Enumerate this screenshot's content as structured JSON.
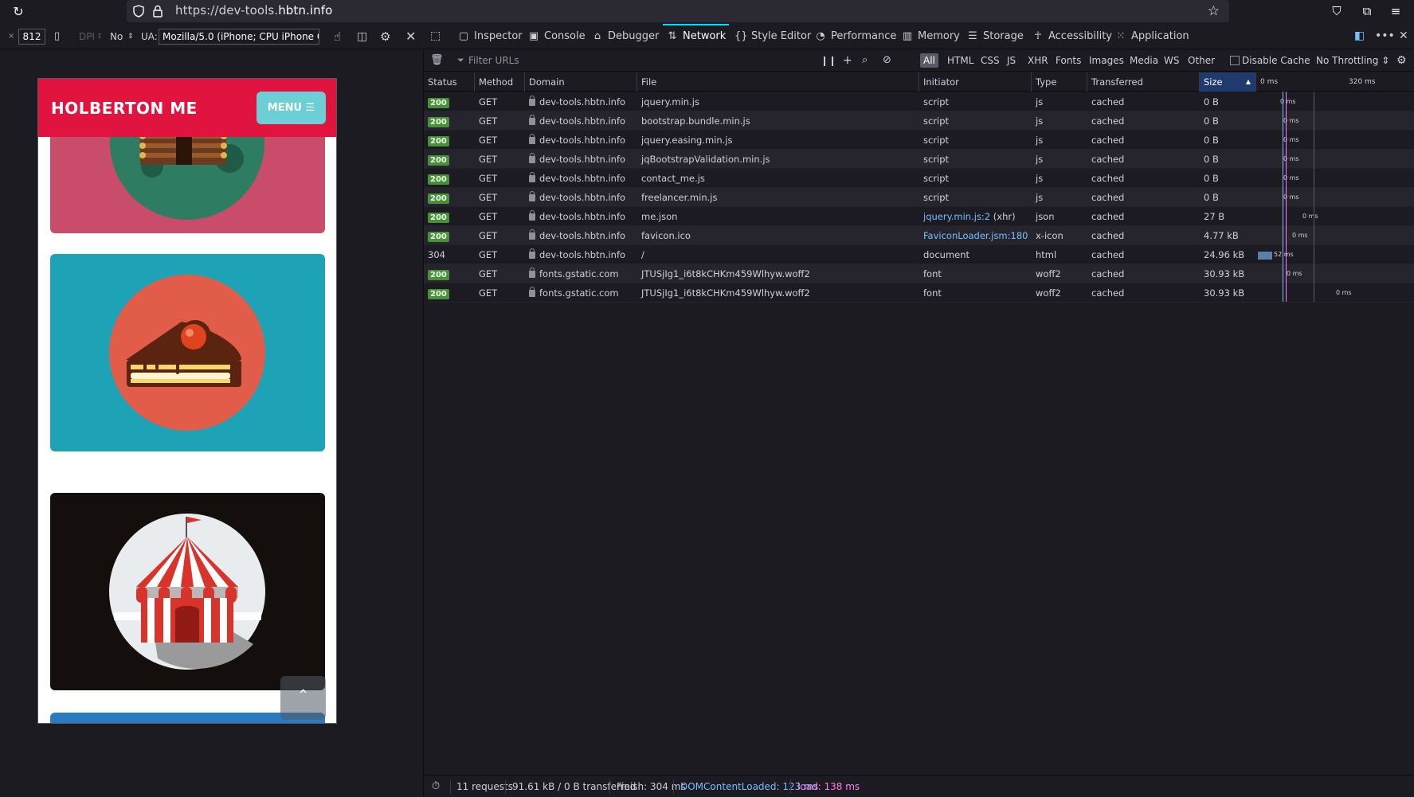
{
  "browser": {
    "url_prefix": "https://dev-tools.",
    "url_domain": "hbtn.info"
  },
  "rdm": {
    "x_label": "×",
    "height": "812",
    "dpi_label": "DPI",
    "throttle_label": "No",
    "ua_label": "UA:",
    "ua_value": "Mozilla/5.0 (iPhone; CPU iPhone OS"
  },
  "site": {
    "brand": "HOLBERTON ME",
    "menu_label": "MENU ☰",
    "scroll_top": "⌃"
  },
  "devtools": {
    "tabs": [
      {
        "label": "Inspector",
        "icon": "inspector-icon"
      },
      {
        "label": "Console",
        "icon": "console-icon"
      },
      {
        "label": "Debugger",
        "icon": "debugger-icon"
      },
      {
        "label": "Network",
        "icon": "network-icon"
      },
      {
        "label": "Style Editor",
        "icon": "style-editor-icon"
      },
      {
        "label": "Performance",
        "icon": "performance-icon"
      },
      {
        "label": "Memory",
        "icon": "memory-icon"
      },
      {
        "label": "Storage",
        "icon": "storage-icon"
      },
      {
        "label": "Accessibility",
        "icon": "accessibility-icon"
      },
      {
        "label": "Application",
        "icon": "application-icon"
      }
    ],
    "selected_tab": "Network"
  },
  "network": {
    "filter_placeholder": "Filter URLs",
    "type_filters": [
      "All",
      "HTML",
      "CSS",
      "JS",
      "XHR",
      "Fonts",
      "Images",
      "Media",
      "WS",
      "Other"
    ],
    "active_filter": "All",
    "disable_cache_label": "Disable Cache",
    "throttling_label": "No Throttling ⇕",
    "columns": {
      "status": "Status",
      "method": "Method",
      "domain": "Domain",
      "file": "File",
      "initiator": "Initiator",
      "type": "Type",
      "transferred": "Transferred",
      "size": "Size",
      "wf_start": "0 ms",
      "wf_end": "320 ms"
    },
    "requests": [
      {
        "status": "200",
        "method": "GET",
        "domain": "dev-tools.hbtn.info",
        "file": "jquery.min.js",
        "initiator": "script",
        "type": "js",
        "transferred": "cached",
        "size": "0 B",
        "wf_time": "0 ms"
      },
      {
        "status": "200",
        "method": "GET",
        "domain": "dev-tools.hbtn.info",
        "file": "bootstrap.bundle.min.js",
        "initiator": "script",
        "type": "js",
        "transferred": "cached",
        "size": "0 B",
        "wf_time": "0 ms"
      },
      {
        "status": "200",
        "method": "GET",
        "domain": "dev-tools.hbtn.info",
        "file": "jquery.easing.min.js",
        "initiator": "script",
        "type": "js",
        "transferred": "cached",
        "size": "0 B",
        "wf_time": "0 ms"
      },
      {
        "status": "200",
        "method": "GET",
        "domain": "dev-tools.hbtn.info",
        "file": "jqBootstrapValidation.min.js",
        "initiator": "script",
        "type": "js",
        "transferred": "cached",
        "size": "0 B",
        "wf_time": "0 ms"
      },
      {
        "status": "200",
        "method": "GET",
        "domain": "dev-tools.hbtn.info",
        "file": "contact_me.js",
        "initiator": "script",
        "type": "js",
        "transferred": "cached",
        "size": "0 B",
        "wf_time": "0 ms"
      },
      {
        "status": "200",
        "method": "GET",
        "domain": "dev-tools.hbtn.info",
        "file": "freelancer.min.js",
        "initiator": "script",
        "type": "js",
        "transferred": "cached",
        "size": "0 B",
        "wf_time": "0 ms"
      },
      {
        "status": "200",
        "method": "GET",
        "domain": "dev-tools.hbtn.info",
        "file": "me.json",
        "initiator": "jquery.min.js:2",
        "initiator_suffix": " (xhr)",
        "type": "json",
        "transferred": "cached",
        "size": "27 B",
        "wf_time": "0 ms"
      },
      {
        "status": "200",
        "method": "GET",
        "domain": "dev-tools.hbtn.info",
        "file": "favicon.ico",
        "initiator": "FaviconLoader.jsm:180 (...",
        "initiator_suffix": "",
        "type": "x-icon",
        "transferred": "cached",
        "size": "4.77 kB",
        "wf_time": "0 ms"
      },
      {
        "status": "304",
        "method": "GET",
        "domain": "dev-tools.hbtn.info",
        "file": "/",
        "initiator": "document",
        "type": "html",
        "transferred": "cached",
        "size": "24.96 kB",
        "wf_time": "52 ms"
      },
      {
        "status": "200",
        "method": "GET",
        "domain": "fonts.gstatic.com",
        "file": "JTUSjIg1_i6t8kCHKm459Wlhyw.woff2",
        "initiator": "font",
        "type": "woff2",
        "transferred": "cached",
        "size": "30.93 kB",
        "wf_time": "0 ms"
      },
      {
        "status": "200",
        "method": "GET",
        "domain": "fonts.gstatic.com",
        "file": "JTUSjIg1_i6t8kCHKm459Wlhyw.woff2",
        "initiator": "font",
        "type": "woff2",
        "transferred": "cached",
        "size": "30.93 kB",
        "wf_time": "0 ms"
      }
    ],
    "summary": {
      "requests": "11 requests",
      "transferred": "91.61 kB / 0 B transferred",
      "finish": "Finish: 304 ms",
      "dcl": "DOMContentLoaded: 123 ms",
      "load": "load: 138 ms"
    }
  },
  "colors": {
    "dcl": "#75bfff",
    "load": "#ff7de9",
    "brand_red": "#e0143f",
    "menu_teal": "#6ccfd6"
  }
}
